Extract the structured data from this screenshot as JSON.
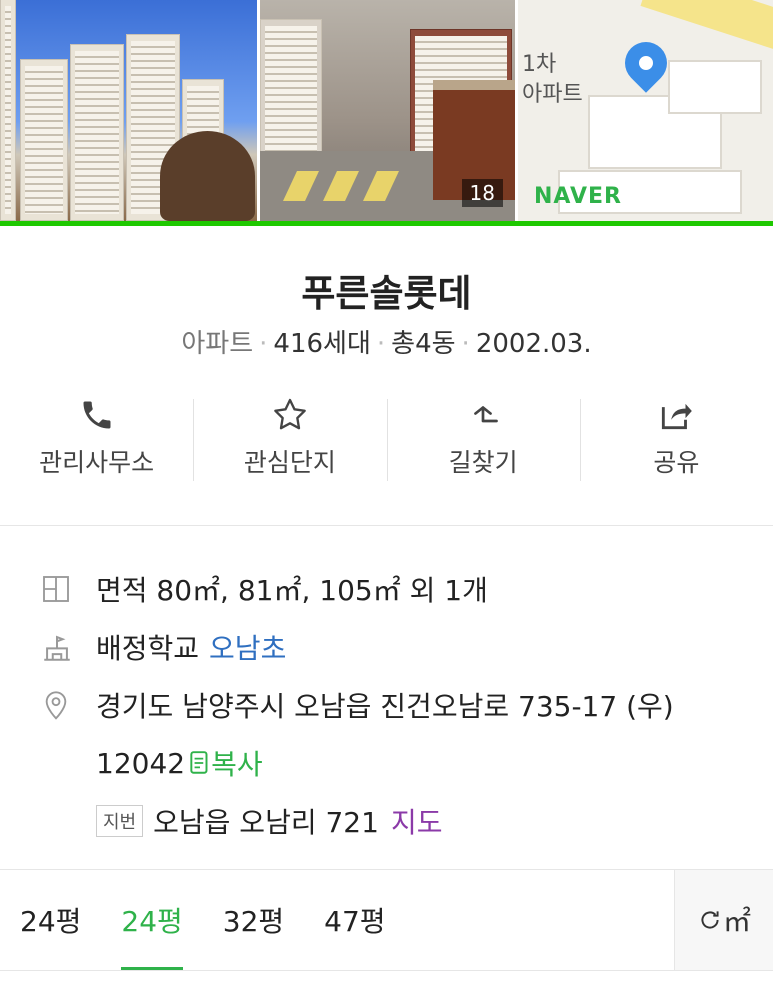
{
  "gallery": {
    "photo_count": "18",
    "map_label": "1차\n아파트",
    "map_brand": "NAVER"
  },
  "complex": {
    "name": "푸른솔롯데",
    "type": "아파트",
    "households": "416세대",
    "buildings": "총4동",
    "date": "2002.03."
  },
  "actions": [
    {
      "label": "관리사무소",
      "icon": "phone-icon"
    },
    {
      "label": "관심단지",
      "icon": "star-icon"
    },
    {
      "label": "길찾기",
      "icon": "directions-icon"
    },
    {
      "label": "공유",
      "icon": "share-icon"
    }
  ],
  "info": {
    "area": "면적 80㎡, 81㎡, 105㎡ 외 1개",
    "school_label": "배정학교",
    "school_link": "오남초",
    "address": "경기도 남양주시 오남읍 진건오남로 735-17 (우)",
    "postcode": "12042",
    "copy_label": "복사",
    "jibun_tag": "지번",
    "jibun_address": "오남읍 오남리 721",
    "map_link": "지도"
  },
  "tabs": [
    {
      "label": "24평",
      "active": false
    },
    {
      "label": "24평",
      "active": true
    },
    {
      "label": "32평",
      "active": false
    },
    {
      "label": "47평",
      "active": false
    }
  ],
  "unit_toggle": "㎡",
  "colors": {
    "accent": "#1ec800",
    "link": "#2f6fc0",
    "map_link": "#8b3aa8",
    "pin": "#3b8ee8"
  }
}
